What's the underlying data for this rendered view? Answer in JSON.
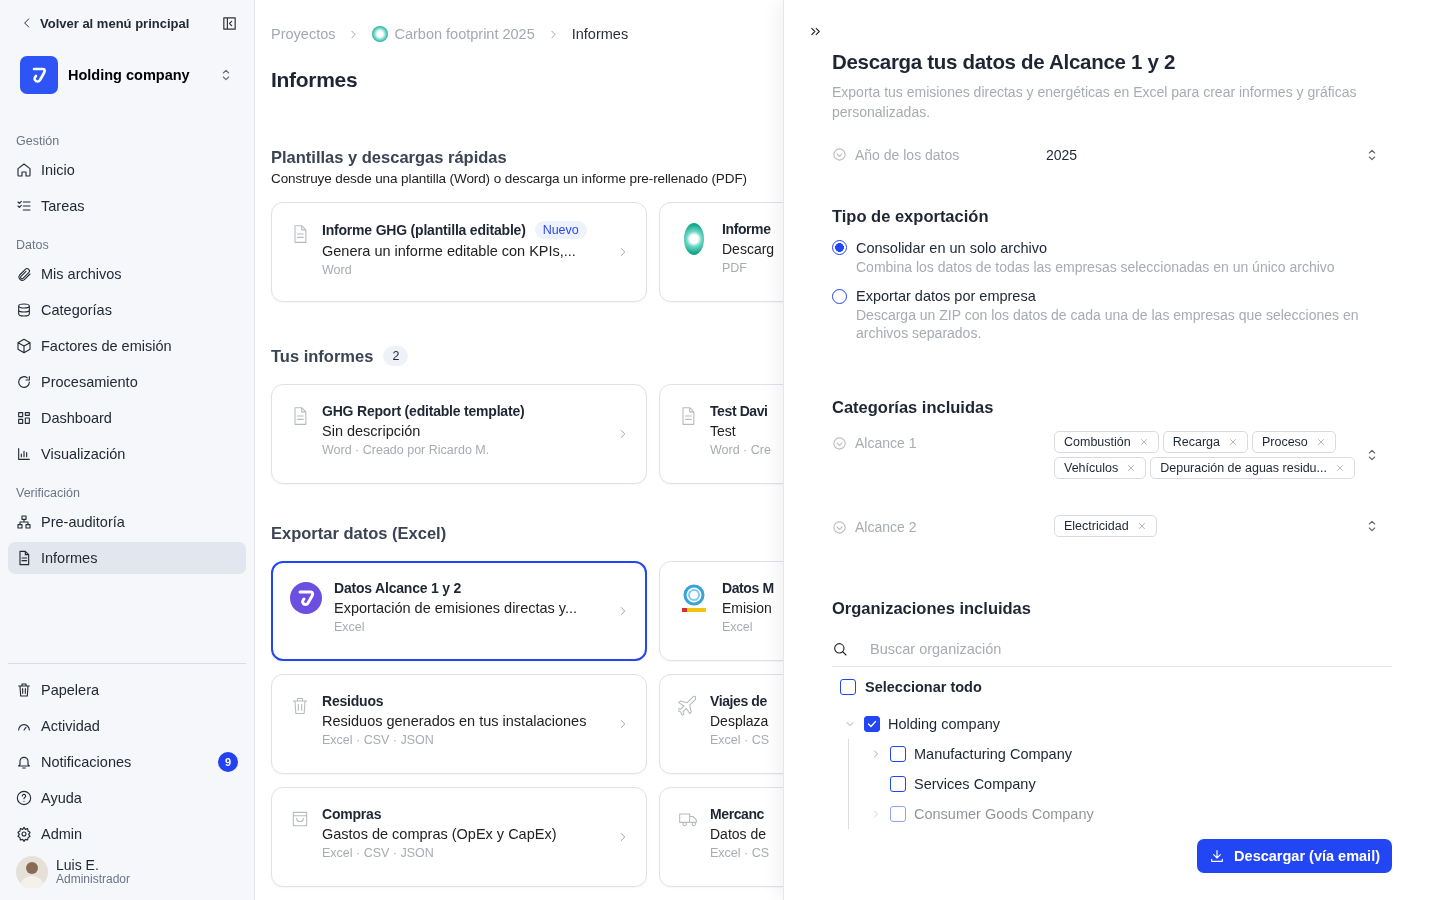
{
  "sidebar": {
    "back_link": "Volver al menú principal",
    "org": "Holding company",
    "sections": [
      {
        "title": "Gestión",
        "items": [
          {
            "label": "Inicio",
            "selected": false
          },
          {
            "label": "Tareas",
            "selected": false
          }
        ]
      },
      {
        "title": "Datos",
        "items": [
          {
            "label": "Mis archivos",
            "selected": false
          },
          {
            "label": "Categorías",
            "selected": false
          },
          {
            "label": "Factores de emisión",
            "selected": false
          },
          {
            "label": "Procesamiento",
            "selected": false
          },
          {
            "label": "Dashboard",
            "selected": false
          },
          {
            "label": "Visualización",
            "selected": false
          }
        ]
      },
      {
        "title": "Verificación",
        "items": [
          {
            "label": "Pre-auditoría",
            "selected": false
          },
          {
            "label": "Informes",
            "selected": true
          }
        ]
      }
    ],
    "bottom_items": [
      {
        "label": "Papelera",
        "selected": false
      },
      {
        "label": "Actividad",
        "selected": false
      },
      {
        "label": "Notificaciones",
        "selected": false,
        "badge": "9"
      },
      {
        "label": "Ayuda",
        "selected": false
      },
      {
        "label": "Admin",
        "selected": false
      }
    ],
    "user": {
      "name": "Luis E.",
      "role": "Administrador"
    }
  },
  "breadcrumb": [
    "Proyectos",
    "Carbon footprint 2025",
    "Informes"
  ],
  "page_title": "Informes",
  "sections": [
    {
      "title": "Plantillas y descargas rápidas",
      "subtitle": "Construye desde una plantilla (Word) o descarga un informe pre-rellenado (PDF)",
      "cards": [
        {
          "title": "Informe GHG (plantilla editable)",
          "badge": "Nuevo",
          "description": "Genera un informe editable con KPIs,...",
          "meta": "Word",
          "selected": false
        },
        {
          "title": "Informe",
          "description": "Descarg",
          "meta": "PDF",
          "selected": false
        }
      ]
    },
    {
      "title": "Tus informes",
      "count": "2",
      "cards": [
        {
          "title": "GHG Report (editable template)",
          "description": "Sin descripción",
          "meta": "Word · Creado por Ricardo M.",
          "selected": false
        },
        {
          "title": "Test Davi",
          "description": "Test",
          "meta": "Word · Cre",
          "selected": false
        }
      ]
    },
    {
      "title": "Exportar datos (Excel)",
      "cards": [
        {
          "title": "Datos Alcance 1 y 2",
          "description": "Exportación de emisiones directas y...",
          "meta": "Excel",
          "selected": true
        },
        {
          "title": "Datos M",
          "description": "Emision",
          "meta": "Excel",
          "selected": false
        },
        {
          "title": "Residuos",
          "description": "Residuos generados en tus instalaciones",
          "meta": "Excel · CSV · JSON",
          "selected": false
        },
        {
          "title": "Viajes de",
          "description": "Desplaza",
          "meta": "Excel · CS",
          "selected": false
        },
        {
          "title": "Compras",
          "description": "Gastos de compras (OpEx y CapEx)",
          "meta": "Excel · CSV · JSON",
          "selected": false
        },
        {
          "title": "Mercanc",
          "description": "Datos de",
          "meta": "Excel · CS",
          "selected": false
        }
      ]
    }
  ],
  "panel": {
    "title": "Descarga tus datos de Alcance 1 y 2",
    "description": "Exporta tus emisiones directas y energéticas en Excel para crear informes y gráficas personalizadas.",
    "year": {
      "label": "Año de los datos",
      "value": "2025"
    },
    "export_type": {
      "title": "Tipo de exportación",
      "options": [
        {
          "label": "Consolidar en un solo archivo",
          "description": "Combina los datos de todas las empresas seleccionadas en un único archivo",
          "selected": true
        },
        {
          "label": "Exportar datos por empresa",
          "description": "Descarga un ZIP con los datos de cada una de las empresas que selecciones en archivos separados.",
          "selected": false
        }
      ]
    },
    "categories": {
      "title": "Categorías incluidas",
      "scopes": [
        {
          "label": "Alcance 1",
          "tags": [
            "Combustión",
            "Recarga",
            "Proceso",
            "Vehículos",
            "Depuración de aguas residu..."
          ]
        },
        {
          "label": "Alcance 2",
          "tags": [
            "Electricidad"
          ]
        }
      ]
    },
    "organizations": {
      "title": "Organizaciones incluidas",
      "search_placeholder": "Buscar organización",
      "select_all": {
        "label": "Seleccionar todo",
        "checked": false
      },
      "tree": [
        {
          "label": "Holding company",
          "checked": true,
          "expanded": true,
          "children": [
            {
              "label": "Manufacturing Company",
              "checked": false,
              "expanded": false
            },
            {
              "label": "Services Company",
              "checked": false
            },
            {
              "label": "Consumer Goods Company",
              "checked": false,
              "expanded": false
            }
          ]
        }
      ]
    },
    "button": "Descargar (vía email)"
  }
}
